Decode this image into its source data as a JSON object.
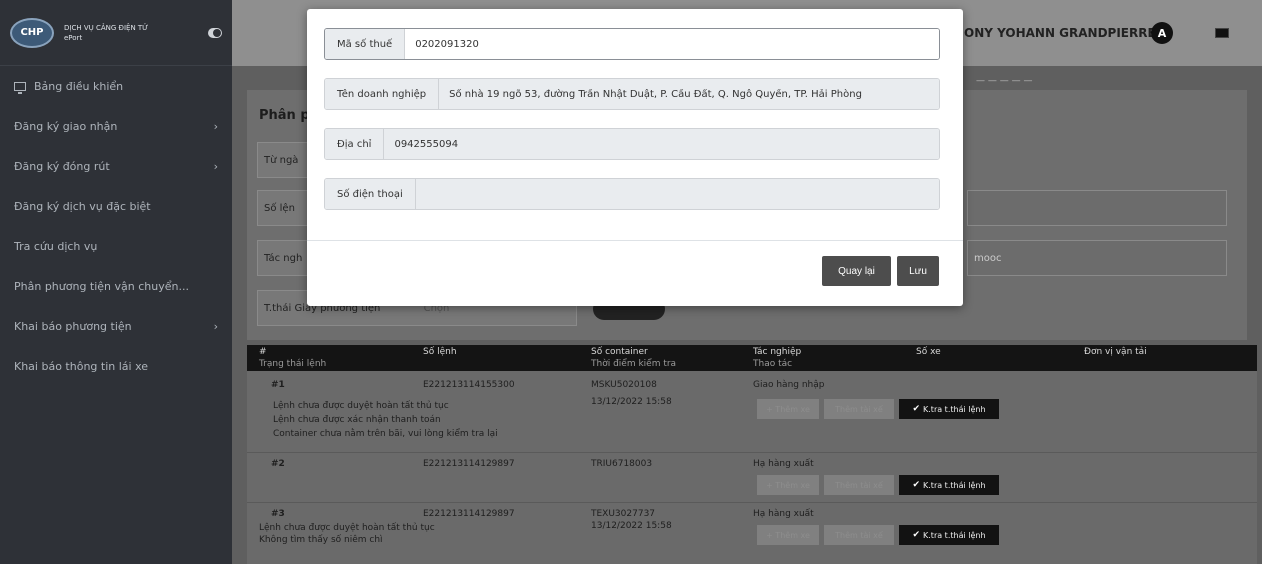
{
  "brand": {
    "logo_text": "CHP",
    "line1": "DỊCH VỤ CẢNG ĐIỆN TỬ",
    "line2": "ePort"
  },
  "sidebar": {
    "items": [
      {
        "label": "Bảng điều khiển"
      },
      {
        "label": "Đăng ký giao nhận"
      },
      {
        "label": "Đăng ký đóng rút"
      },
      {
        "label": "Đăng ký dịch vụ đặc biệt"
      },
      {
        "label": "Tra cứu dịch vụ"
      },
      {
        "label": "Phân phương tiện vận chuyển..."
      },
      {
        "label": "Khai báo phương tiện"
      },
      {
        "label": "Khai báo thông tin lái xe"
      }
    ]
  },
  "header": {
    "user_name": "ONY YOHANN GRANDPIERRE",
    "avatar_letter": "A"
  },
  "page": {
    "title": "Phân p",
    "filters": {
      "from_date": "Từ ngà",
      "order_no": "Số lện",
      "operation": "Tác ngh",
      "status": "T.thái Giấy phương tiện",
      "status_value": "Chọn",
      "trailer": "mooc"
    }
  },
  "table": {
    "headers": {
      "col1_top": "#",
      "col1_bottom": "Trạng thái lệnh",
      "col2": "Số lệnh",
      "col3_top": "Số container",
      "col3_bottom": "Thời điểm kiểm tra",
      "col4_top": "Tác nghiệp",
      "col4_bottom": "Thao tác",
      "col5": "Số xe",
      "col6": "Đơn vị vận tải"
    },
    "rows": [
      {
        "index": "#1",
        "order_no": "E221213114155300",
        "container": "MSKU5020108",
        "checked_at": "13/12/2022 15:58",
        "operation": "Giao hàng nhập",
        "status1": "Lệnh chưa được duyệt hoàn tất thủ tục",
        "status2": "Lệnh chưa được xác nhận thanh toán",
        "status3": "Container chưa nằm trên bãi, vui lòng kiểm tra lại"
      },
      {
        "index": "#2",
        "order_no": "E221213114129897",
        "container": "TRIU6718003",
        "checked_at": "",
        "operation": "Hạ hàng xuất",
        "status1": "",
        "status2": "",
        "status3": ""
      },
      {
        "index": "#3",
        "order_no": "E221213114129897",
        "container": "TEXU3027737",
        "checked_at": "13/12/2022 15:58",
        "operation": "Hạ hàng xuất",
        "status1": "Lệnh chưa được duyệt hoàn tất thủ tục",
        "status2": "Không tìm thấy số niêm chì",
        "status3": ""
      }
    ],
    "action_add": "+ Thêm xe",
    "action_driver": "Thêm tài xế",
    "action_check": "K.tra t.thái lệnh"
  },
  "modal": {
    "tax_code_label": "Mã số thuế",
    "tax_code_value": "0202091320",
    "company_label": "Tên doanh nghiệp",
    "company_value": "Số nhà 19 ngõ 53, đường Trần Nhật Duật, P. Cầu Đất, Q. Ngô Quyền, TP. Hải Phòng",
    "address_label": "Địa chỉ",
    "address_value": "0942555094",
    "phone_label": "Số điện thoại",
    "phone_value": "",
    "back_label": "Quay lại",
    "save_label": "Lưu"
  }
}
